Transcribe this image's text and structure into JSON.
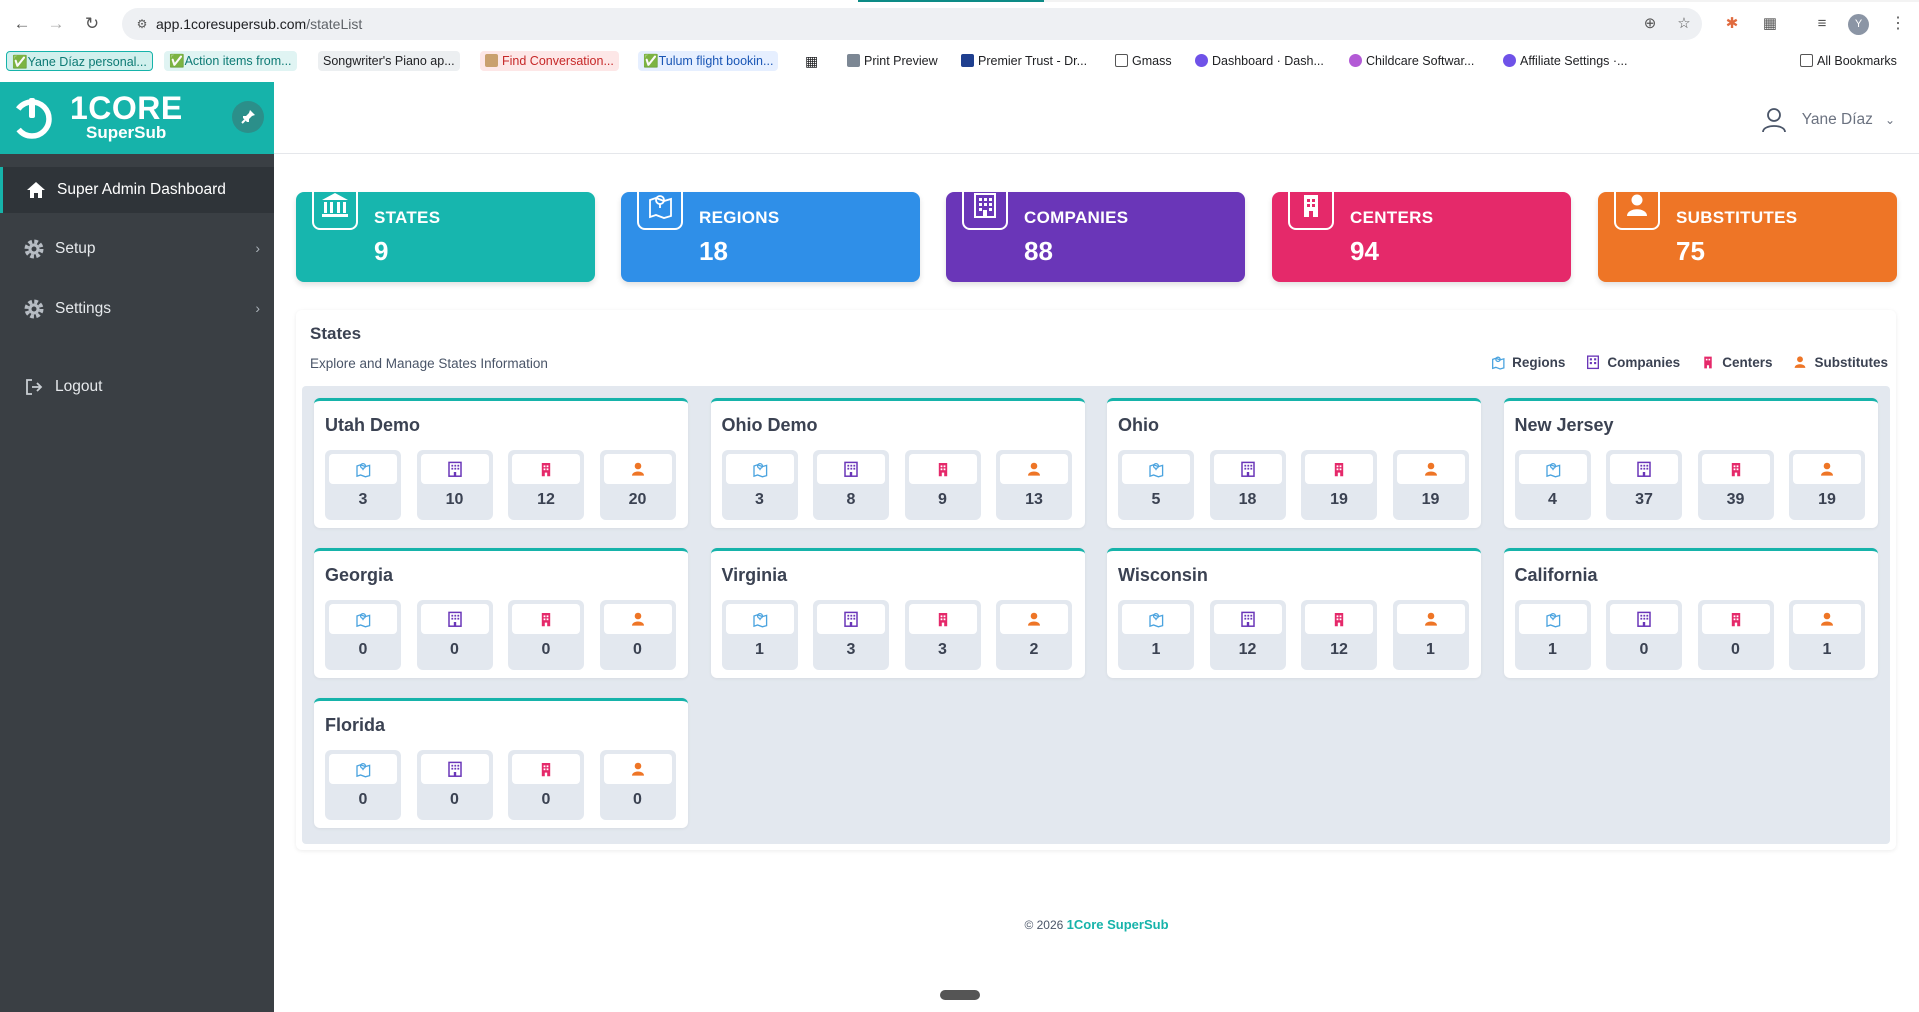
{
  "browser": {
    "url_domain": "app.1coresupersub.com",
    "url_path": "/stateList",
    "profile_initial": "Y",
    "bookmarks": [
      {
        "label": "✅Yane Díaz personal...",
        "color": "#d1f0ed",
        "text_color": "#0d7a74"
      },
      {
        "label": "✅Action items from...",
        "color": "#e0f4f3",
        "text_color": "#0d7a74"
      },
      {
        "label": "Songwriter's Piano ap...",
        "color": "#eceff1",
        "text_color": "#202124"
      },
      {
        "label": "Find Conversation...",
        "color": "#fde7e7",
        "text_color": "#c62828"
      },
      {
        "label": "✅Tulum flight bookin...",
        "color": "#e6efff",
        "text_color": "#1a56b5"
      },
      {
        "label": "Print Preview",
        "color": "#ffffff",
        "text_color": "#202124"
      },
      {
        "label": "Premier Trust - Dr...",
        "color": "#ffffff",
        "text_color": "#202124"
      },
      {
        "label": "Gmass",
        "color": "#ffffff",
        "text_color": "#202124"
      },
      {
        "label": "Dashboard · Dash...",
        "color": "#ffffff",
        "text_color": "#202124"
      },
      {
        "label": "Childcare Softwar...",
        "color": "#ffffff",
        "text_color": "#202124"
      },
      {
        "label": "Affiliate Settings ·...",
        "color": "#ffffff",
        "text_color": "#202124"
      },
      {
        "label": "All Bookmarks",
        "color": "#ffffff",
        "text_color": "#202124"
      }
    ]
  },
  "brand": {
    "name": "1CORE",
    "sub": "SuperSub",
    "color": "#16b3aa"
  },
  "sidebar": {
    "items": [
      {
        "label": "Super Admin Dashboard",
        "icon": "home-icon"
      },
      {
        "label": "Setup",
        "icon": "gear-icon"
      },
      {
        "label": "Settings",
        "icon": "gear-icon"
      },
      {
        "label": "Logout",
        "icon": "logout-icon"
      }
    ]
  },
  "user": {
    "name": "Yane Díaz"
  },
  "stats": [
    {
      "label": "STATES",
      "value": "9",
      "color": "#17b6ae",
      "icon": "bank-icon"
    },
    {
      "label": "REGIONS",
      "value": "18",
      "color": "#2f8fe8",
      "icon": "map-icon"
    },
    {
      "label": "COMPANIES",
      "value": "88",
      "color": "#6a36b8",
      "icon": "building-icon"
    },
    {
      "label": "CENTERS",
      "value": "94",
      "color": "#e5296a",
      "icon": "center-icon"
    },
    {
      "label": "SUBSTITUTES",
      "value": "75",
      "color": "#ee7526",
      "icon": "person-icon"
    }
  ],
  "panel": {
    "title": "States",
    "subtitle": "Explore and Manage States Information",
    "legend": [
      {
        "label": "Regions",
        "icon": "map-icon",
        "color": "#4aa3df"
      },
      {
        "label": "Companies",
        "icon": "building-icon",
        "color": "#6a36b8"
      },
      {
        "label": "Centers",
        "icon": "center-icon",
        "color": "#e5296a"
      },
      {
        "label": "Substitutes",
        "icon": "person-icon",
        "color": "#ee7526"
      }
    ]
  },
  "states": [
    {
      "name": "Utah Demo",
      "regions": "3",
      "companies": "10",
      "centers": "12",
      "substitutes": "20"
    },
    {
      "name": "Ohio Demo",
      "regions": "3",
      "companies": "8",
      "centers": "9",
      "substitutes": "13"
    },
    {
      "name": "Ohio",
      "regions": "5",
      "companies": "18",
      "centers": "19",
      "substitutes": "19"
    },
    {
      "name": "New Jersey",
      "regions": "4",
      "companies": "37",
      "centers": "39",
      "substitutes": "19"
    },
    {
      "name": "Georgia",
      "regions": "0",
      "companies": "0",
      "centers": "0",
      "substitutes": "0"
    },
    {
      "name": "Virginia",
      "regions": "1",
      "companies": "3",
      "centers": "3",
      "substitutes": "2"
    },
    {
      "name": "Wisconsin",
      "regions": "1",
      "companies": "12",
      "centers": "12",
      "substitutes": "1"
    },
    {
      "name": "California",
      "regions": "1",
      "companies": "0",
      "centers": "0",
      "substitutes": "1"
    },
    {
      "name": "Florida",
      "regions": "0",
      "companies": "0",
      "centers": "0",
      "substitutes": "0"
    }
  ],
  "footer": {
    "copyright": "© 2026",
    "brand": "1Core SuperSub"
  }
}
